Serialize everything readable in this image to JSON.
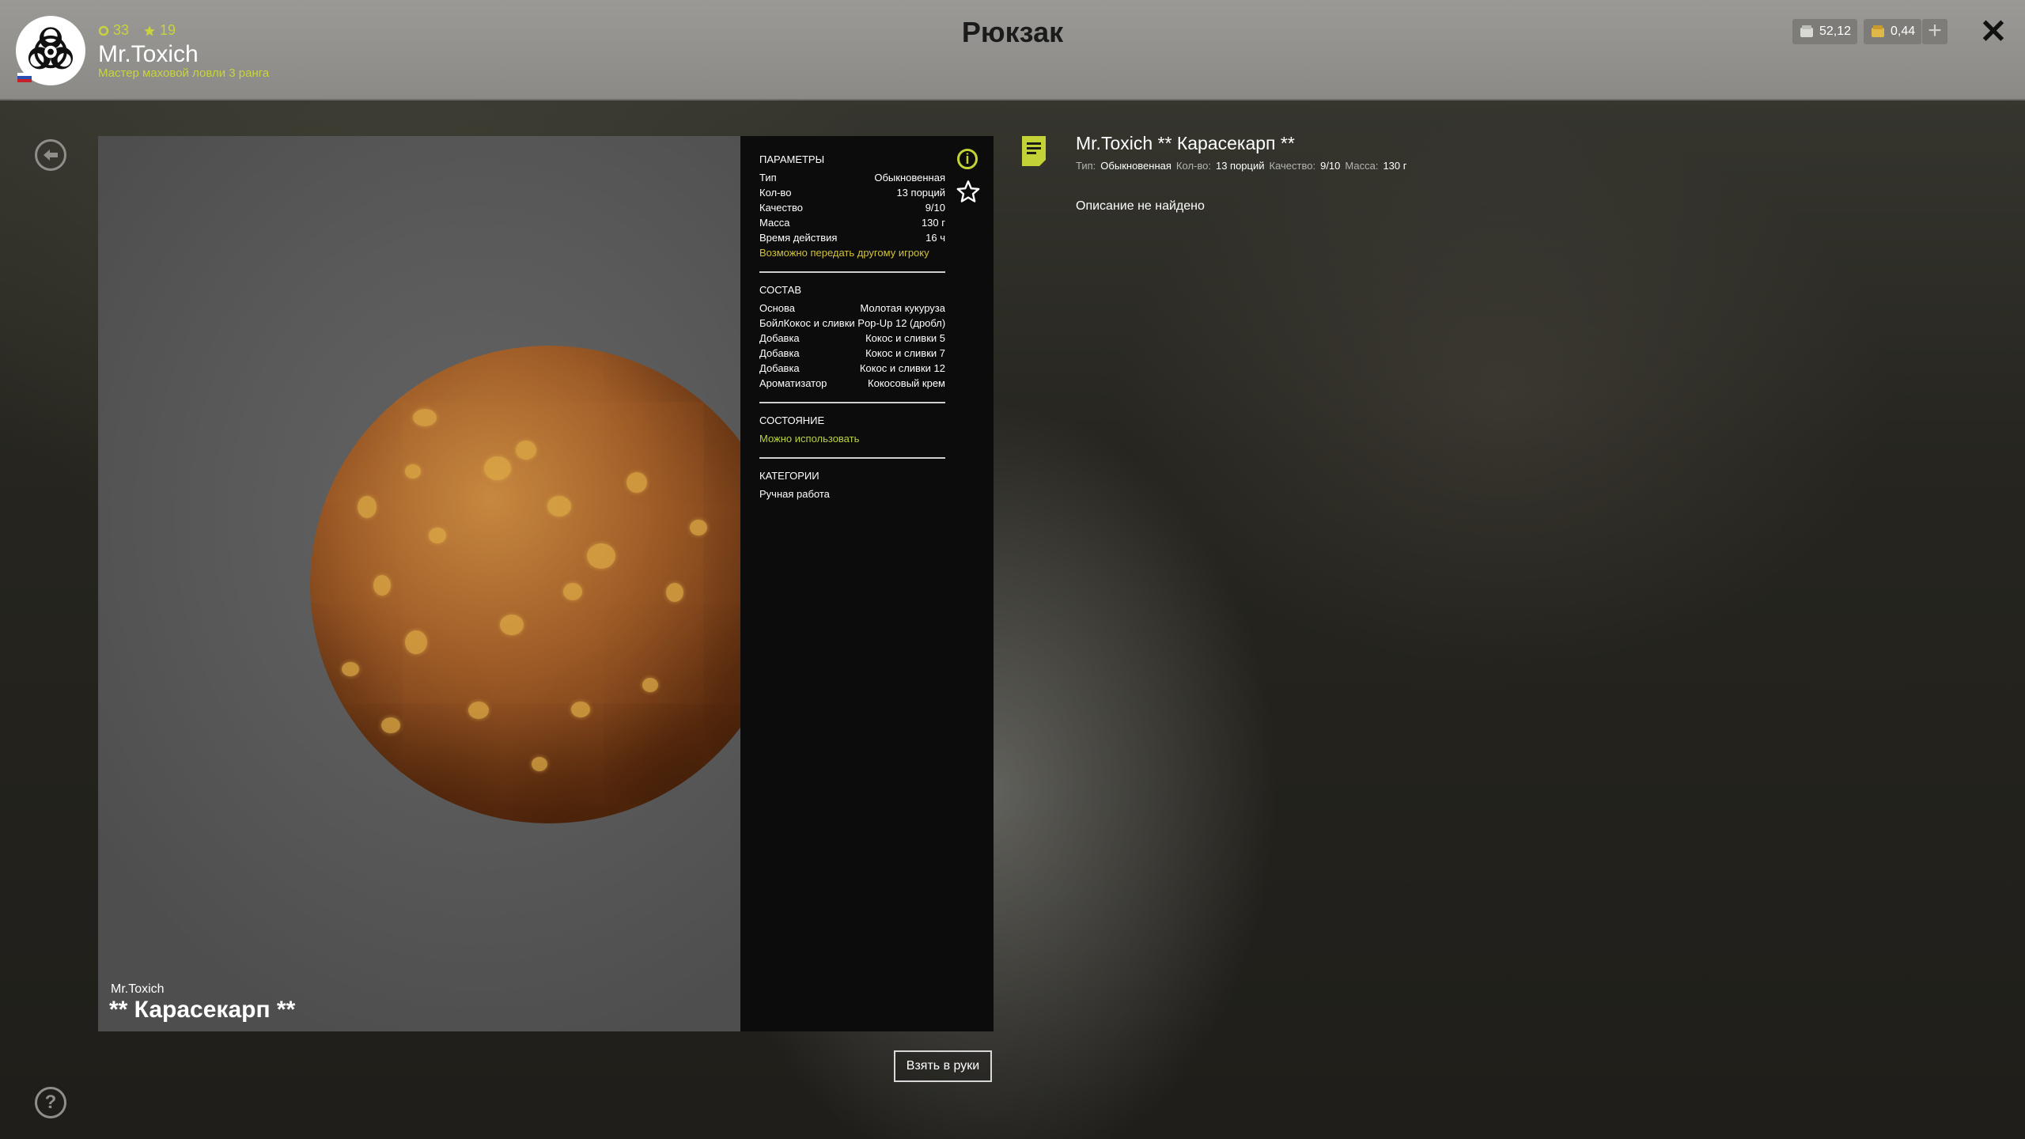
{
  "header": {
    "title": "Рюкзак",
    "level": "33",
    "stars": "19",
    "username": "Mr.Toxich",
    "rank": "Мастер маховой ловли 3 ранга",
    "silver": "52,12",
    "gold": "0,44",
    "plus_label": "+"
  },
  "colors": {
    "accent": "#c9d33d",
    "panel": "#0c0c0c",
    "topbar": "#8f8e8a"
  },
  "preview": {
    "owner": "Mr.Toxich",
    "item_name": "** Карасекарп **"
  },
  "info": {
    "params_title": "ПАРАМЕТРЫ",
    "params": [
      {
        "k": "Тип",
        "v": "Обыкновенная"
      },
      {
        "k": "Кол-во",
        "v": "13 порций"
      },
      {
        "k": "Качество",
        "v": "9/10"
      },
      {
        "k": "Масса",
        "v": "130 г"
      },
      {
        "k": "Время действия",
        "v": "16 ч"
      }
    ],
    "transfer_note": "Возможно передать другому игроку",
    "composition_title": "СОСТАВ",
    "composition": [
      {
        "k": "Основа",
        "v": "Молотая кукуруза"
      },
      {
        "k": "Бойл",
        "v": "Кокос и сливки Pop-Up 12 (дробл)"
      },
      {
        "k": "Добавка",
        "v": "Кокос и сливки 5"
      },
      {
        "k": "Добавка",
        "v": "Кокос и сливки 7"
      },
      {
        "k": "Добавка",
        "v": "Кокос и сливки 12"
      },
      {
        "k": "Ароматизатор",
        "v": "Кокосовый крем"
      }
    ],
    "state_title": "СОСТОЯНИЕ",
    "state_value": "Можно использовать",
    "categories_title": "КАТЕГОРИИ",
    "category_value": "Ручная работа"
  },
  "actions": {
    "take_label": "Взять в руки"
  },
  "detail": {
    "title": "Mr.Toxich ** Карасекарп **",
    "meta": [
      {
        "k": "Тип:",
        "v": "Обыкновенная"
      },
      {
        "k": "Кол-во:",
        "v": "13 порций"
      },
      {
        "k": "Качество:",
        "v": "9/10"
      },
      {
        "k": "Масса:",
        "v": "130 г"
      }
    ],
    "description": "Описание не найдено"
  },
  "icons": [
    "biohazard-icon",
    "coin-icon",
    "star-icon",
    "silver-icon",
    "gold-icon",
    "close-icon",
    "back-icon",
    "help-icon",
    "info-icon",
    "favorite-star-icon",
    "document-icon"
  ]
}
